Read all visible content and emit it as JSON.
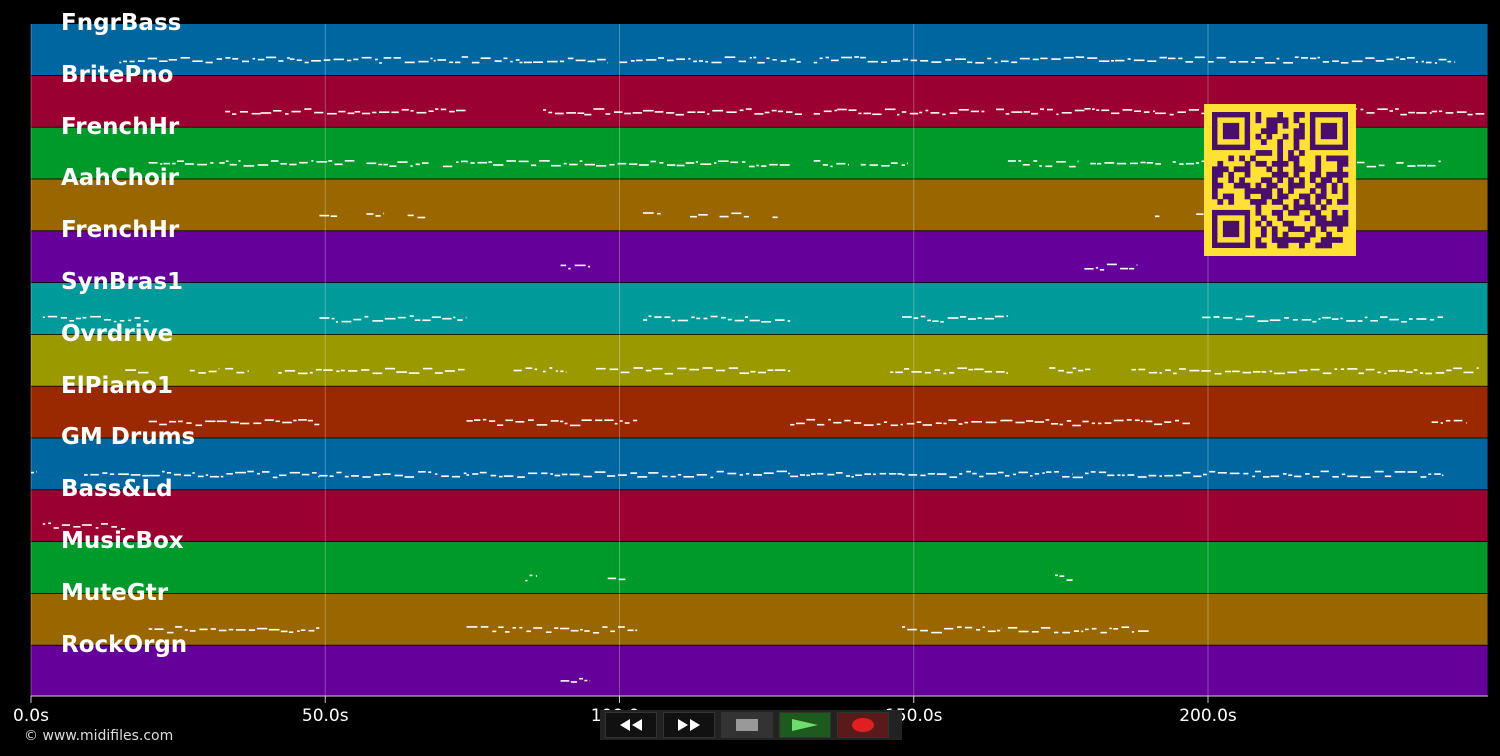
{
  "timeline": {
    "ticks": [
      {
        "seconds": 0,
        "label": "0.0s"
      },
      {
        "seconds": 50,
        "label": "50.0s"
      },
      {
        "seconds": 100,
        "label": "100.0s"
      },
      {
        "seconds": 150,
        "label": "150.0s"
      },
      {
        "seconds": 200,
        "label": "200.0s"
      }
    ],
    "end_seconds": 247.5
  },
  "tracks": [
    {
      "name": "FngrBass",
      "color": "#0066a0",
      "segments": [
        [
          15,
          44
        ],
        [
          44,
          83
        ],
        [
          83,
          98
        ],
        [
          100,
          131
        ],
        [
          133,
          178
        ],
        [
          178,
          208
        ],
        [
          208,
          242
        ]
      ]
    },
    {
      "name": "BritePno",
      "color": "#9a0032",
      "segments": [
        [
          33,
          39
        ],
        [
          39,
          47
        ],
        [
          47,
          55
        ],
        [
          55,
          74
        ],
        [
          87,
          94
        ],
        [
          94,
          104
        ],
        [
          104,
          131
        ],
        [
          133,
          137
        ],
        [
          137,
          162
        ],
        [
          164,
          179
        ],
        [
          179,
          181
        ],
        [
          181,
          191
        ],
        [
          191,
          222
        ],
        [
          222,
          238
        ],
        [
          238,
          247
        ]
      ]
    },
    {
      "name": "FrenchHr",
      "color": "#009a2a",
      "segments": [
        [
          20,
          31
        ],
        [
          32,
          55
        ],
        [
          57,
          68
        ],
        [
          70,
          96
        ],
        [
          96,
          129
        ],
        [
          133,
          139
        ],
        [
          141,
          149
        ],
        [
          166,
          178
        ],
        [
          180,
          192
        ],
        [
          194,
          230
        ],
        [
          232,
          240
        ]
      ]
    },
    {
      "name": "AahChoir",
      "color": "#9a6600",
      "segments": [
        [
          49,
          52
        ],
        [
          57,
          60
        ],
        [
          64,
          67
        ],
        [
          104,
          107
        ],
        [
          112,
          115
        ],
        [
          117,
          122
        ],
        [
          126,
          127
        ],
        [
          191,
          192
        ],
        [
          198,
          200
        ],
        [
          205,
          213
        ],
        [
          215,
          216
        ],
        [
          219,
          221
        ]
      ]
    },
    {
      "name": "FrenchHr",
      "color": "#66009a",
      "segments": [
        [
          90,
          95
        ],
        [
          179,
          188
        ]
      ]
    },
    {
      "name": "SynBras1",
      "color": "#009a9a",
      "segments": [
        [
          2,
          20
        ],
        [
          49,
          74
        ],
        [
          104,
          129
        ],
        [
          148,
          166
        ],
        [
          199,
          240
        ]
      ]
    },
    {
      "name": "Ovrdrive",
      "color": "#9a9a00",
      "segments": [
        [
          16,
          20
        ],
        [
          27,
          32
        ],
        [
          33,
          37
        ],
        [
          42,
          74
        ],
        [
          82,
          86
        ],
        [
          87,
          91
        ],
        [
          96,
          129
        ],
        [
          146,
          166
        ],
        [
          173,
          177
        ],
        [
          177,
          180
        ],
        [
          187,
          246
        ]
      ]
    },
    {
      "name": "ElPiano1",
      "color": "#9a2800",
      "segments": [
        [
          20,
          49
        ],
        [
          74,
          103
        ],
        [
          129,
          165
        ],
        [
          165,
          197
        ],
        [
          238,
          244
        ]
      ]
    },
    {
      "name": "GM Drums",
      "color": "#0066a0",
      "segments": [
        [
          0,
          1
        ],
        [
          9,
          20
        ],
        [
          20,
          49
        ],
        [
          49,
          74
        ],
        [
          74,
          103
        ],
        [
          103,
          129
        ],
        [
          129,
          148
        ],
        [
          148,
          177
        ],
        [
          177,
          208
        ],
        [
          208,
          240
        ]
      ]
    },
    {
      "name": "Bass&Ld",
      "color": "#9a0032",
      "segments": [
        [
          2,
          16
        ]
      ]
    },
    {
      "name": "MusicBox",
      "color": "#009a2a",
      "segments": [
        [
          84,
          86
        ],
        [
          98,
          101
        ],
        [
          174,
          177
        ]
      ]
    },
    {
      "name": "MuteGtr",
      "color": "#9a6600",
      "segments": [
        [
          20,
          49
        ],
        [
          74,
          103
        ],
        [
          148,
          165
        ],
        [
          166,
          190
        ]
      ]
    },
    {
      "name": "RockOrgn",
      "color": "#66009a",
      "segments": [
        [
          90,
          95
        ]
      ]
    }
  ],
  "transport": {
    "buttons": [
      {
        "name": "rewind-button",
        "icon": "rewind-icon"
      },
      {
        "name": "fast-forward-button",
        "icon": "fast-forward-icon"
      },
      {
        "name": "stop-button",
        "icon": "stop-icon"
      },
      {
        "name": "play-button",
        "icon": "play-icon"
      },
      {
        "name": "record-button",
        "icon": "record-icon"
      }
    ]
  },
  "footer": {
    "copyright": "© www.midifiles.com"
  },
  "overlay": {
    "icon": "qr-code-icon",
    "fg": "#ffe135",
    "bg": "#4a0f6a"
  }
}
